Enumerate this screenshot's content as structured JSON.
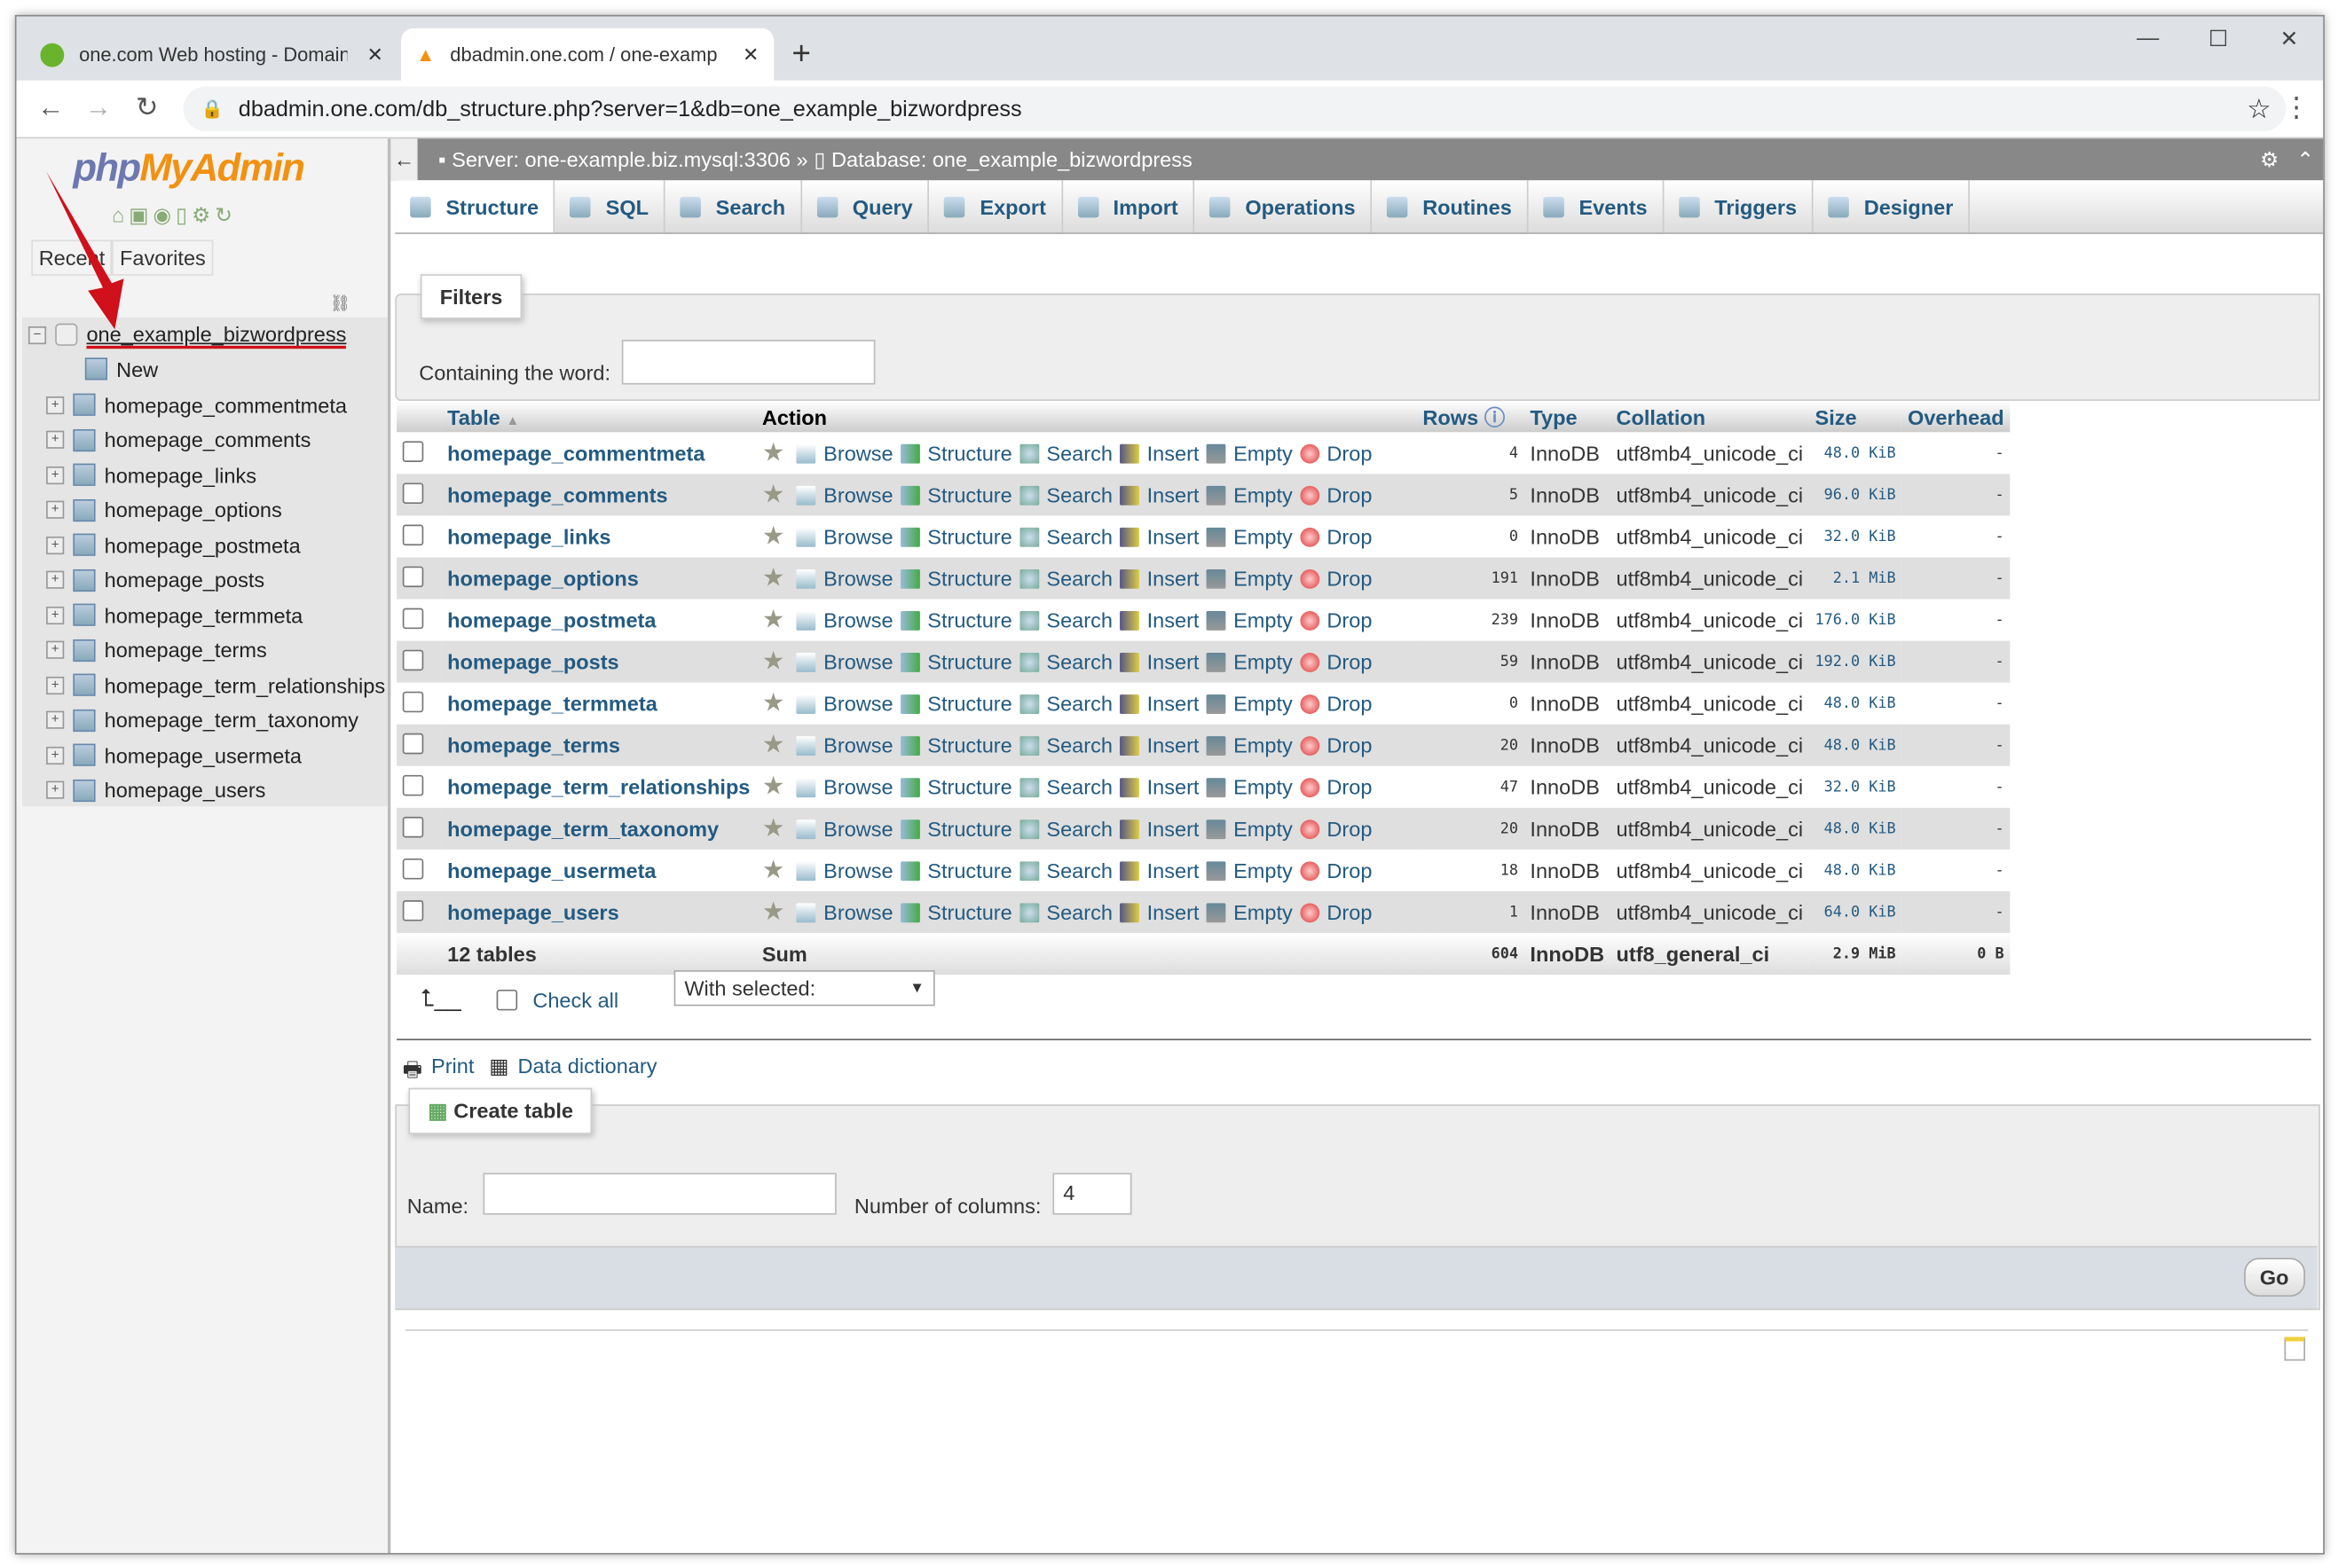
{
  "browser": {
    "tabs": [
      {
        "title": "one.com Web hosting  -  Domain"
      },
      {
        "title": "dbadmin.one.com / one-example"
      }
    ],
    "url": "dbadmin.one.com/db_structure.php?server=1&db=one_example_bizwordpress"
  },
  "sidebar": {
    "logo": "phpMyAdmin",
    "tabs": [
      "Recent",
      "Favorites"
    ],
    "database": "one_example_bizwordpress",
    "new_label": "New",
    "tables": [
      "homepage_commentmeta",
      "homepage_comments",
      "homepage_links",
      "homepage_options",
      "homepage_postmeta",
      "homepage_posts",
      "homepage_termmeta",
      "homepage_terms",
      "homepage_term_relationships",
      "homepage_term_taxonomy",
      "homepage_usermeta",
      "homepage_users"
    ]
  },
  "breadcrumb": {
    "server": "Server: one-example.biz.mysql:3306 »",
    "database": "Database: one_example_bizwordpress"
  },
  "menu": [
    "Structure",
    "SQL",
    "Search",
    "Query",
    "Export",
    "Import",
    "Operations",
    "Routines",
    "Events",
    "Triggers",
    "Designer"
  ],
  "filters": {
    "title": "Filters",
    "label": "Containing the word:",
    "value": ""
  },
  "table": {
    "headers": [
      "Table",
      "Action",
      "Rows",
      "Type",
      "Collation",
      "Size",
      "Overhead"
    ],
    "actions": [
      "Browse",
      "Structure",
      "Search",
      "Insert",
      "Empty",
      "Drop"
    ],
    "rows": [
      [
        "homepage_commentmeta",
        "4",
        "InnoDB",
        "utf8mb4_unicode_ci",
        "48.0 KiB",
        "-"
      ],
      [
        "homepage_comments",
        "5",
        "InnoDB",
        "utf8mb4_unicode_ci",
        "96.0 KiB",
        "-"
      ],
      [
        "homepage_links",
        "0",
        "InnoDB",
        "utf8mb4_unicode_ci",
        "32.0 KiB",
        "-"
      ],
      [
        "homepage_options",
        "191",
        "InnoDB",
        "utf8mb4_unicode_ci",
        "2.1 MiB",
        "-"
      ],
      [
        "homepage_postmeta",
        "239",
        "InnoDB",
        "utf8mb4_unicode_ci",
        "176.0 KiB",
        "-"
      ],
      [
        "homepage_posts",
        "59",
        "InnoDB",
        "utf8mb4_unicode_ci",
        "192.0 KiB",
        "-"
      ],
      [
        "homepage_termmeta",
        "0",
        "InnoDB",
        "utf8mb4_unicode_ci",
        "48.0 KiB",
        "-"
      ],
      [
        "homepage_terms",
        "20",
        "InnoDB",
        "utf8mb4_unicode_ci",
        "48.0 KiB",
        "-"
      ],
      [
        "homepage_term_relationships",
        "47",
        "InnoDB",
        "utf8mb4_unicode_ci",
        "32.0 KiB",
        "-"
      ],
      [
        "homepage_term_taxonomy",
        "20",
        "InnoDB",
        "utf8mb4_unicode_ci",
        "48.0 KiB",
        "-"
      ],
      [
        "homepage_usermeta",
        "18",
        "InnoDB",
        "utf8mb4_unicode_ci",
        "48.0 KiB",
        "-"
      ],
      [
        "homepage_users",
        "1",
        "InnoDB",
        "utf8mb4_unicode_ci",
        "64.0 KiB",
        "-"
      ]
    ],
    "footer": {
      "count": "12 tables",
      "sum": "Sum",
      "rows": "604",
      "type": "InnoDB",
      "collation": "utf8_general_ci",
      "size": "2.9 MiB",
      "overhead": "0 B"
    }
  },
  "bulk": {
    "check_all": "Check all",
    "with_selected": "With selected:"
  },
  "links": {
    "print": "Print",
    "data_dictionary": "Data dictionary"
  },
  "create": {
    "title": "Create table",
    "name_label": "Name:",
    "name_value": "",
    "cols_label": "Number of columns:",
    "cols_value": "4",
    "go": "Go"
  }
}
